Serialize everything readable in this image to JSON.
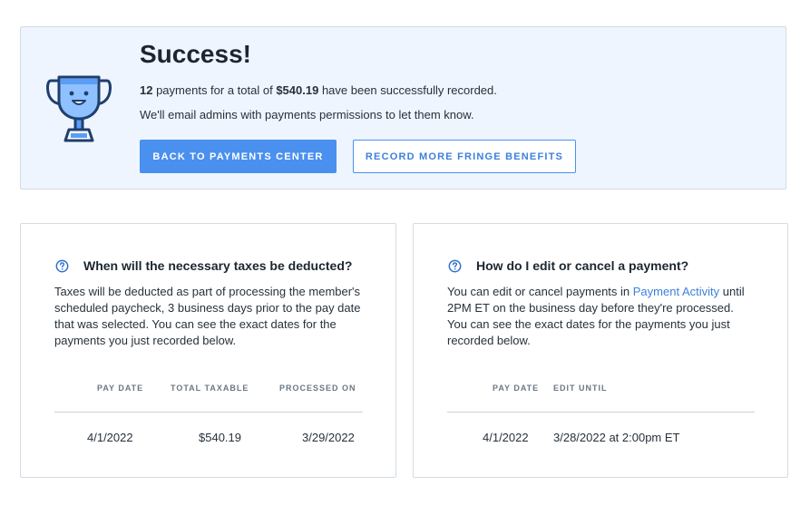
{
  "banner": {
    "title": "Success!",
    "count": "12",
    "summary_mid": " payments for a total of ",
    "amount": "$540.19",
    "summary_end": " have been successfully recorded.",
    "email_note": "We'll email admins with payments permissions to let them know.",
    "primary_button": "BACK TO PAYMENTS CENTER",
    "secondary_button": "RECORD MORE FRINGE BENEFITS",
    "icon": "trophy-icon"
  },
  "taxes_card": {
    "icon": "question-circle-icon",
    "title": "When will the necessary taxes be deducted?",
    "body": "Taxes will be deducted as part of processing the member's scheduled paycheck, 3 business days prior to the pay date that was selected. You can see the exact dates for the payments you just recorded below.",
    "columns": [
      "PAY DATE",
      "TOTAL TAXABLE",
      "PROCESSED ON"
    ],
    "rows": [
      [
        "4/1/2022",
        "$540.19",
        "3/29/2022"
      ]
    ]
  },
  "edit_card": {
    "icon": "question-circle-icon",
    "title": "How do I edit or cancel a payment?",
    "body_start": "You can edit or cancel payments in ",
    "body_link": "Payment Activity",
    "body_end": " until 2PM ET on the business day before they're processed. You can see the exact dates for the payments you just recorded below.",
    "columns": [
      "PAY DATE",
      "EDIT UNTIL"
    ],
    "rows": [
      [
        "4/1/2022",
        "3/28/2022 at 2:00pm ET"
      ]
    ]
  },
  "colors": {
    "accent": "#4a90ee",
    "banner_bg": "#eef5fe",
    "icon_blue": "#2f6fd1",
    "icon_dark": "#1f3f6e"
  }
}
